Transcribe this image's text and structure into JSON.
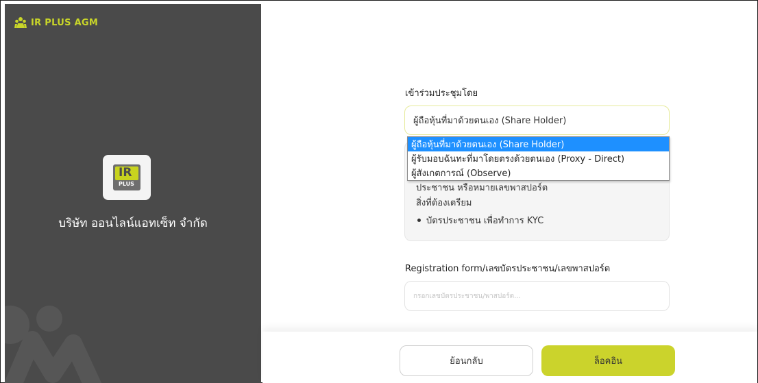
{
  "brand": {
    "app_name": "IR PLUS AGM",
    "company_logo_text": "IR",
    "company_logo_subtext": "PLUS",
    "company_name": "บริษัท ออนไลน์แอทเซ็ท จำกัด"
  },
  "form": {
    "attend_label": "เข้าร่วมประชุมโดย",
    "attend_selected": "ผู้ถือหุ้นที่มาด้วยตนเอง (Share Holder)",
    "attend_options": [
      "ผู้ถือหุ้นที่มาด้วยตนเอง (Share Holder)",
      "ผู้รับมอบฉันทะที่มาโดยตรงด้วยตนเอง (Proxy - Direct)",
      "ผู้สังเกตการณ์ (Observe)"
    ],
    "info_line1": "ประชาชน หรือหมายเลขพาสปอร์ต",
    "info_line2": "สิ่งที่ต้องเตรียม",
    "info_bullet": "บัตรประชาชน เพื่อทำการ KYC",
    "registration_label": "Registration form/เลขบัตรประชาชน/เลขพาสปอร์ต",
    "registration_placeholder": "กรอกเลขบัตรประชาชน/พาสปอร์ต...",
    "registration_value": ""
  },
  "footer": {
    "back_label": "ย้อนกลับ",
    "login_label": "ล็อคอิน"
  },
  "colors": {
    "accent": "#cbd32c",
    "panel": "#4a4a4a",
    "selected_option": "#1e90ff"
  }
}
